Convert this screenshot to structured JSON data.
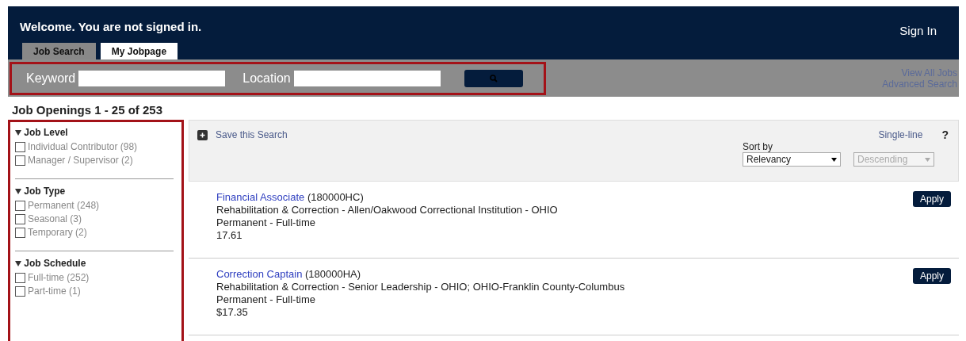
{
  "header": {
    "welcome": "Welcome. You are not signed in.",
    "sign_in": "Sign In"
  },
  "tabs": [
    {
      "label": "Job Search",
      "selected": false
    },
    {
      "label": "My Jobpage",
      "selected": true
    }
  ],
  "search": {
    "keyword_label": "Keyword",
    "location_label": "Location",
    "links": [
      "View All Jobs",
      "Advanced Search"
    ]
  },
  "results_title": "Job Openings 1 - 25 of 253",
  "filters": [
    {
      "title": "Job Level",
      "expanded": true,
      "options": [
        {
          "label": "Individual Contributor",
          "count": "(98)",
          "checked": false
        },
        {
          "label": "Manager / Supervisor",
          "count": "(2)",
          "checked": false
        }
      ]
    },
    {
      "title": "Job Type",
      "expanded": true,
      "options": [
        {
          "label": "Permanent",
          "count": "(248)",
          "checked": false
        },
        {
          "label": "Seasonal",
          "count": "(3)",
          "checked": false
        },
        {
          "label": "Temporary",
          "count": "(2)",
          "checked": false
        }
      ]
    },
    {
      "title": "Job Schedule",
      "expanded": true,
      "options": [
        {
          "label": "Full-time",
          "count": "(252)",
          "checked": false
        },
        {
          "label": "Part-time",
          "count": "(1)",
          "checked": false
        }
      ]
    }
  ],
  "toolbar": {
    "save": "Save this Search",
    "view": "Single-line",
    "help": "?",
    "sort_label": "Sort by",
    "sort_by": {
      "value": "Relevancy",
      "disabled": false
    },
    "order": {
      "value": "Descending",
      "disabled": true
    }
  },
  "jobs": [
    {
      "title": "Financial Associate",
      "code": "(180000HC)",
      "location": "Rehabilitation & Correction - Allen/Oakwood Correctional Institution - OHIO",
      "type": "Permanent - Full-time",
      "pay": "17.61",
      "apply": "Apply"
    },
    {
      "title": "Correction Captain",
      "code": "(180000HA)",
      "location": "Rehabilitation & Correction - Senior Leadership - OHIO; OHIO-Franklin County-Columbus",
      "type": "Permanent - Full-time",
      "pay": "$17.35",
      "apply": "Apply"
    }
  ]
}
